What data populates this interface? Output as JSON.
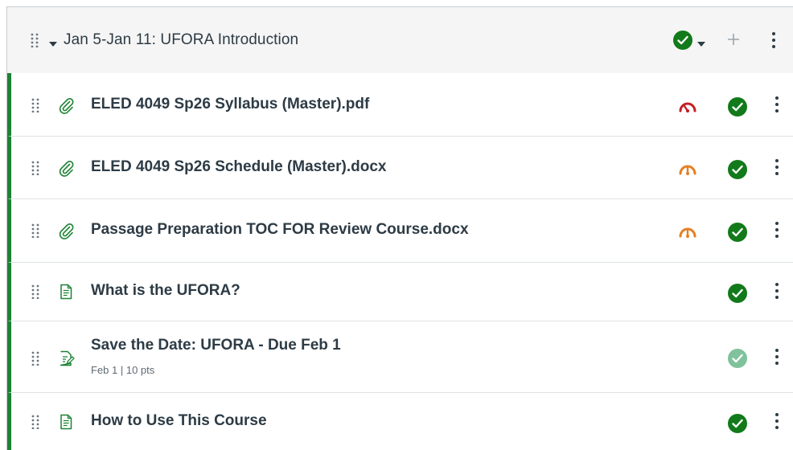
{
  "module": {
    "title": "Jan 5-Jan 11: UFORA Introduction",
    "status": "published",
    "actions": {
      "publish_icon": "check-circle-icon",
      "add_icon": "plus-icon",
      "more_icon": "kebab-icon"
    }
  },
  "items": [
    {
      "title": "ELED 4049 Sp26 Syllabus (Master).pdf",
      "type_icon": "attachment-icon",
      "accessibility": "low",
      "published": true
    },
    {
      "title": "ELED 4049 Sp26 Schedule (Master).docx",
      "type_icon": "attachment-icon",
      "accessibility": "medium",
      "published": true
    },
    {
      "title": "Passage Preparation TOC FOR Review Course.docx",
      "type_icon": "attachment-icon",
      "accessibility": "medium",
      "published": true
    },
    {
      "title": "What is the UFORA?",
      "type_icon": "page-icon",
      "published": true
    },
    {
      "title": "Save the Date: UFORA - Due Feb 1",
      "meta": "Feb 1  |  10 pts",
      "type_icon": "assignment-icon",
      "published": "pending"
    },
    {
      "title": "How to Use This Course",
      "type_icon": "page-icon",
      "published": true
    }
  ],
  "colors": {
    "published": "#127a1b",
    "pending": "#7fc29b",
    "accent_border": "#1d8234",
    "gauge_low": "#c41e24",
    "gauge_medium": "#e67e22",
    "icon_green": "#1d8234"
  }
}
